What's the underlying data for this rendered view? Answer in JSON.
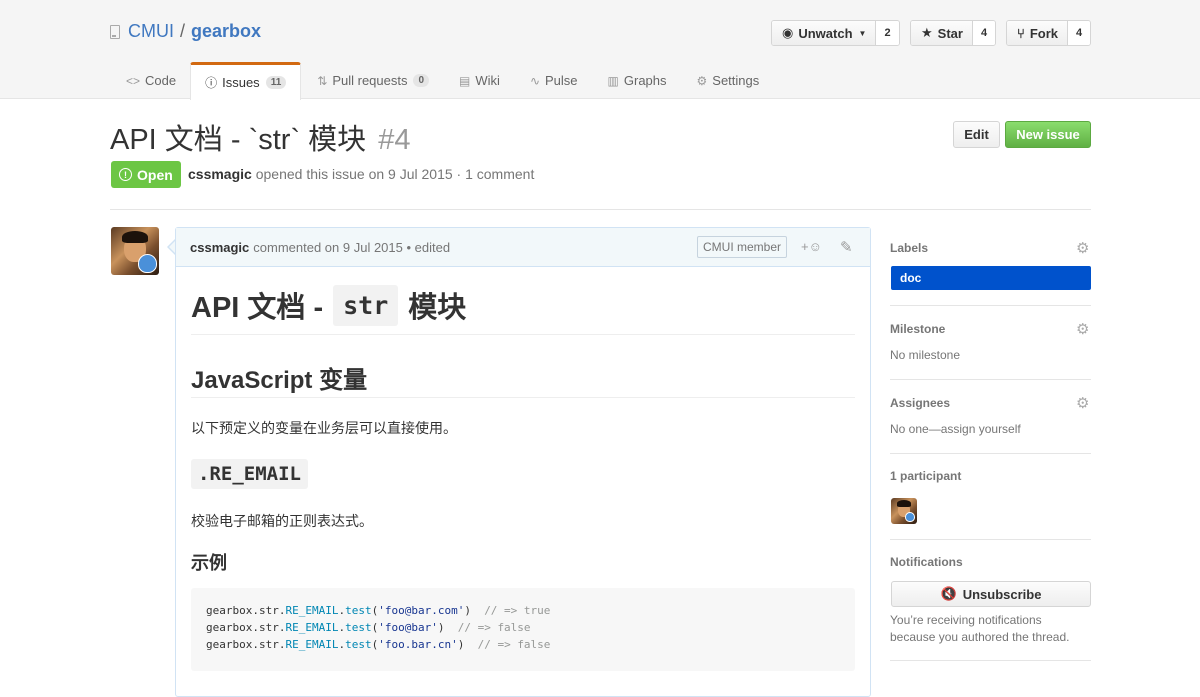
{
  "repo": {
    "owner": "CMUI",
    "separator": "/",
    "name": "gearbox"
  },
  "actions": {
    "watch": {
      "label": "Unwatch",
      "count": "2"
    },
    "star": {
      "label": "Star",
      "count": "4"
    },
    "fork": {
      "label": "Fork",
      "count": "4"
    }
  },
  "tabs": [
    {
      "label": "Code"
    },
    {
      "label": "Issues",
      "count": "11"
    },
    {
      "label": "Pull requests",
      "count": "0"
    },
    {
      "label": "Wiki"
    },
    {
      "label": "Pulse"
    },
    {
      "label": "Graphs"
    },
    {
      "label": "Settings"
    }
  ],
  "issue": {
    "title": "API 文档 - `str` 模块",
    "number": "#4",
    "state": "Open",
    "author": "cssmagic",
    "meta_text": "opened this issue on 9 Jul 2015 · 1 comment",
    "edit_label": "Edit",
    "new_label": "New issue"
  },
  "comment": {
    "author": "cssmagic",
    "meta": "commented on 9 Jul 2015 • edited",
    "badge": "CMUI member",
    "react": "+☺",
    "h1_pre": "API 文档 -",
    "h1_code": "str",
    "h1_post": "模块",
    "h2": "JavaScript 变量",
    "p1": "以下预定义的变量在业务层可以直接使用。",
    "h3": ".RE_EMAIL",
    "p2": "校验电子邮箱的正则表达式。",
    "h4": "示例",
    "code_lines": [
      {
        "obj": "gearbox.str.",
        "prop": "RE_EMAIL",
        "dot": ".",
        "fn": "test",
        "open": "(",
        "arg": "'foo@bar.com'",
        "close": ")",
        "pad": "  ",
        "comment": "// => true"
      },
      {
        "obj": "gearbox.str.",
        "prop": "RE_EMAIL",
        "dot": ".",
        "fn": "test",
        "open": "(",
        "arg": "'foo@bar'",
        "close": ")",
        "pad": "  ",
        "comment": "// => false"
      },
      {
        "obj": "gearbox.str.",
        "prop": "RE_EMAIL",
        "dot": ".",
        "fn": "test",
        "open": "(",
        "arg": "'foo.bar.cn'",
        "close": ")",
        "pad": "  ",
        "comment": "// => false"
      }
    ]
  },
  "sidebar": {
    "labels_title": "Labels",
    "label": "doc",
    "milestone_title": "Milestone",
    "milestone_value": "No milestone",
    "assignees_title": "Assignees",
    "assignees_value": "No one—assign yourself",
    "participants_title": "1 participant",
    "notifications_title": "Notifications",
    "unsubscribe_label": "Unsubscribe",
    "reason": "You’re receiving notifications because you authored the thread."
  },
  "colors": {
    "accent_tab": "#d26911",
    "open_state": "#6cc644",
    "label_doc": "#0052cc",
    "link": "#4078c0"
  }
}
